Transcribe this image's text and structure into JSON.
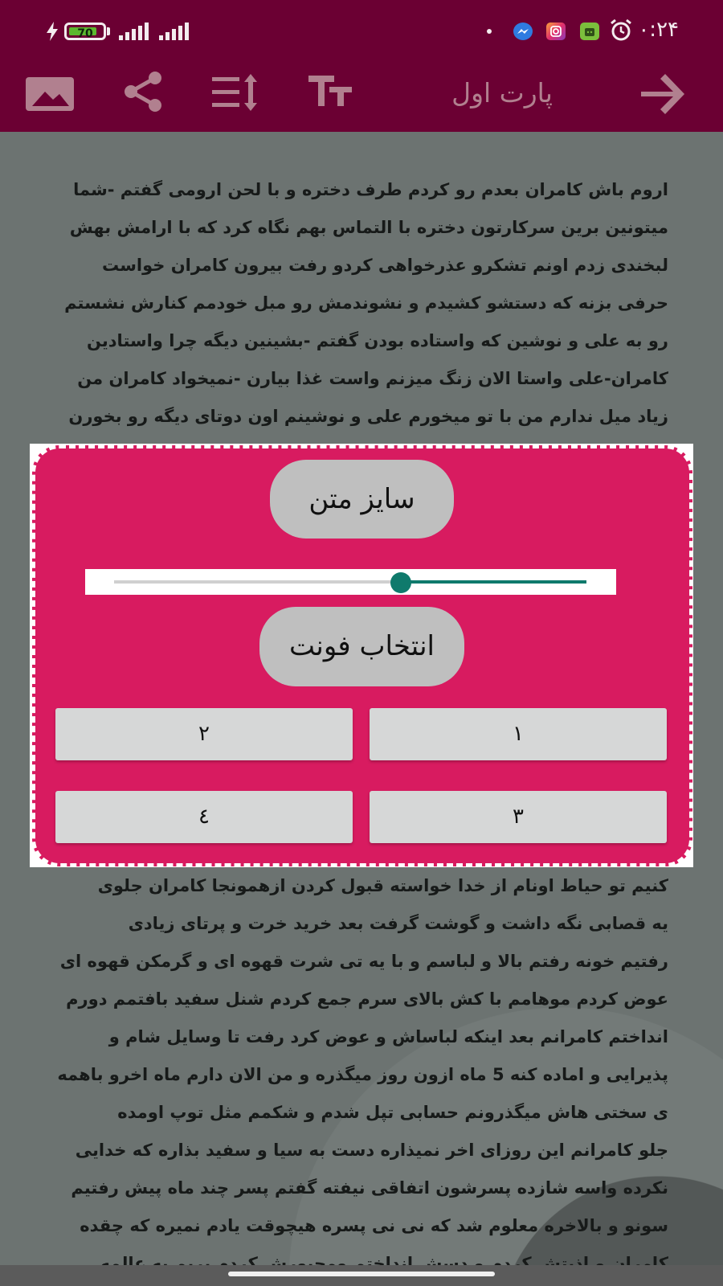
{
  "status_bar": {
    "time": "۰:۲۴",
    "battery_level": "70",
    "charging": true,
    "icons": [
      "alarm-icon",
      "android-app-icon",
      "instagram-icon",
      "messenger-icon",
      "dot-icon",
      "signal-icon",
      "charging-icon"
    ]
  },
  "appbar": {
    "title": "پارت اول",
    "actions": [
      "back-arrow-icon",
      "text-size-icon",
      "line-spacing-icon",
      "share-icon",
      "image-icon"
    ]
  },
  "story": {
    "lines_top": [
      "اروم باش کامران بعدم رو کردم طرف دختره و با لحن ارومی گفتم -شما",
      "میتونین برین سرکارتون دختره با التماس بهم نگاه کرد که با ارامش بهش",
      "لبخندی زدم اونم تشکرو عذرخواهی کردو رفت بیرون کامران خواست",
      "حرفی بزنه که دستشو کشیدم و نشوندمش رو مبل خودمم کنارش نشستم",
      "رو به علی و نوشین که واستاده بودن گفتم -بشینین دیگه چرا واستادین",
      "کامران-علی واستا الان زنگ میزنم واست غذا بیارن -نمیخواد کامران من",
      "زیاد میل ندارم من با تو میخورم علی و نوشینم اون دوتای دیگه رو بخورن"
    ],
    "lines_bottom": [
      "کنیم تو حیاط اونام از خدا خواسته قبول کردن ازهمونجا کامران جلوی",
      "یه قصابی نگه داشت و گوشت گرفت بعد خرید خرت و پرتای زیادی",
      "رفتیم خونه رفتم بالا و لباسم و با یه تی شرت قهوه ای و گرمکن قهوه ای",
      "عوض کردم موهامم با کش بالای سرم جمع کردم شنل سفید بافتمم دورم",
      "انداختم کامرانم بعد اینکه لباساش و عوض کرد رفت تا وسایل شام و",
      "پذیرایی و اماده کنه 5 ماه ازون روز میگذره و من الان دارم ماه اخرو باهمه",
      "ی سختی هاش میگذرونم حسابی تپل شدم و شکمم مثل توپ اومده",
      "جلو کامرانم این روزای اخر نمیذاره دست به سیا و سفید بذاره که خدایی",
      "نکرده واسه شازده پسرشون اتفاقی نیفته گفتم پسر چند ماه پیش رفتیم",
      "سونو و بالاخره معلوم شد که نی نی پسره هیچوقت یادم نمیره که چقده",
      "کامران و اذیتش کردم و دسش انداختم ومجبورش کردم بریم به عالمه"
    ]
  },
  "dialog": {
    "text_size_label": "سایز متن",
    "slider_value": 0.61,
    "font_select_label": "انتخاب فونت",
    "font_buttons": [
      "۱",
      "۲",
      "۳",
      "٤"
    ]
  },
  "colors": {
    "appbar": "#6b0033",
    "dialog": "#d81b60",
    "slider_accent": "#0f7a6c",
    "pill": "#bfbfbf"
  }
}
